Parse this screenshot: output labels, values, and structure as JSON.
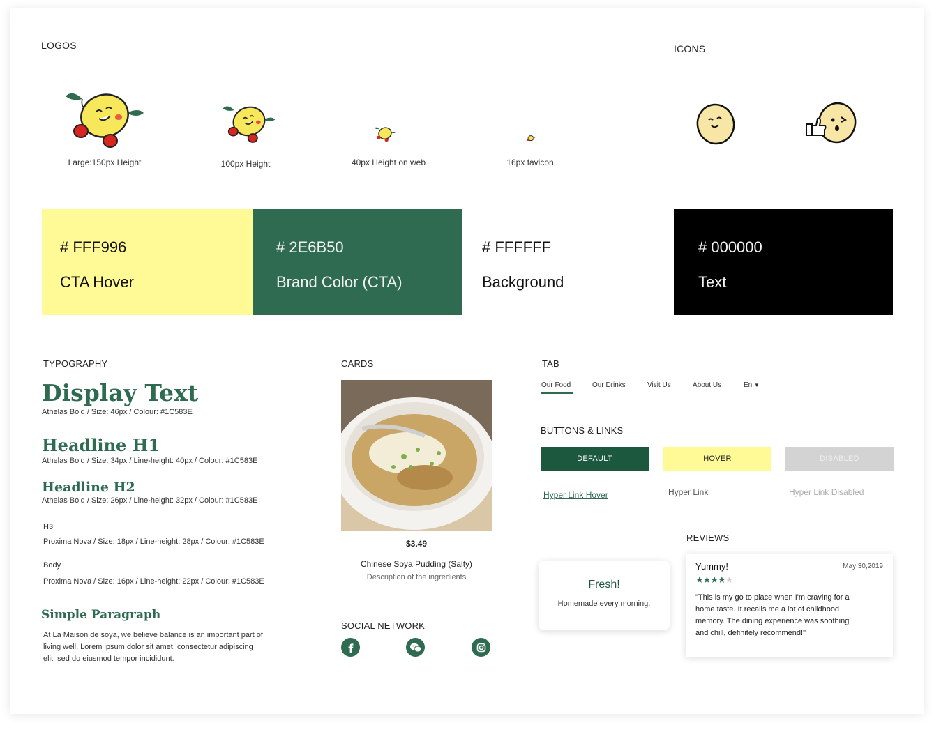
{
  "colors": {
    "cta_hover": "#FFF996",
    "brand": "#2E6B50",
    "background": "#FFFFFF",
    "text": "#000000",
    "heading_green": "#1C583E",
    "disabled_gray": "#D3D3D3",
    "star": "#2E6B50"
  },
  "logos": {
    "title": "LOGOS",
    "items": [
      {
        "caption": "Large:150px Height"
      },
      {
        "caption": "100px Height"
      },
      {
        "caption": "40px Height on web"
      },
      {
        "caption": "16px favicon"
      }
    ]
  },
  "icons": {
    "title": "ICONS",
    "items": [
      "bean-smile-icon",
      "bean-thumbs-up-wink-icon"
    ]
  },
  "palette": [
    {
      "hex": "# FFF996",
      "role": "CTA Hover"
    },
    {
      "hex": "# 2E6B50",
      "role": "Brand Color (CTA)"
    },
    {
      "hex": "# FFFFFF",
      "role": "Background"
    },
    {
      "hex": "# 000000",
      "role": "Text"
    }
  ],
  "typography": {
    "title": "TYPOGRAPHY",
    "display": {
      "sample": "Display Text",
      "spec": "Athelas Bold / Size: 46px / Colour: #1C583E"
    },
    "h1": {
      "sample": "Headline H1",
      "spec": "Athelas  Bold / Size: 34px / Line-height: 40px / Colour: #1C583E"
    },
    "h2": {
      "sample": "Headline H2",
      "spec": "Athelas Bold / Size: 26px / Line-height: 32px / Colour: #1C583E"
    },
    "h3": {
      "sample": "H3",
      "spec": "Proxima Nova / Size: 18px / Line-height: 28px / Colour: #1C583E"
    },
    "body": {
      "sample": "Body",
      "spec": "Proxima Nova / Size: 16px / Line-height: 22px / Colour: #1C583E"
    },
    "paragraph": {
      "title": "Simple Paragraph",
      "lines": [
        "At La Maison de soya, we believe balance is an important part of",
        "living well. Lorem ipsum dolor sit amet, consectetur adipiscing",
        "elit, sed do eiusmod tempor incididunt."
      ]
    }
  },
  "cards": {
    "title": "CARDS",
    "price": "$3.49",
    "name": "Chinese Soya Pudding (Salty)",
    "description": "Description of the ingredients"
  },
  "social": {
    "title": "SOCIAL NETWORK",
    "items": [
      "facebook-icon",
      "wechat-icon",
      "instagram-icon"
    ]
  },
  "tab": {
    "title": "TAB",
    "items": [
      {
        "label": "Our Food",
        "active": true
      },
      {
        "label": "Our Drinks"
      },
      {
        "label": "Visit Us"
      },
      {
        "label": "About Us"
      },
      {
        "label": "En"
      }
    ]
  },
  "buttons": {
    "title": "BUTTONS & LINKS",
    "default_label": "DEFAULT",
    "hover_label": "HOVER",
    "disabled_label": "DISABLED",
    "link_hover": "Hyper Link Hover",
    "link": "Hyper Link",
    "link_disabled": "Hyper Link Disabled"
  },
  "feature_card": {
    "title": "Fresh!",
    "text": "Homemade every morning."
  },
  "reviews": {
    "title": "REVIEWS",
    "review_title": "Yummy!",
    "date": "May 30,2019",
    "rating": 4,
    "max_rating": 5,
    "lines": [
      "\"This is my go to place when I'm craving for a",
      "home taste. It recalls me a lot of childhood",
      "memory. The dining experience was soothing",
      "and chill, definitely recommend!\""
    ]
  }
}
